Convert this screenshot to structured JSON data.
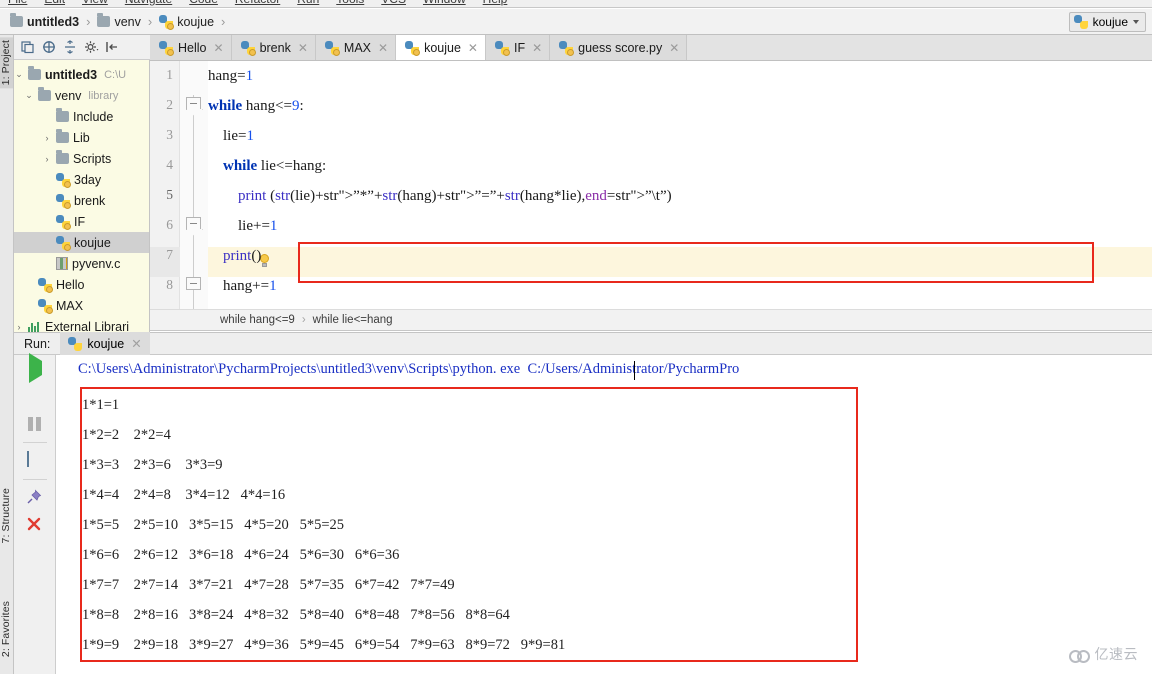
{
  "menubar": {
    "items": [
      "File",
      "Edit",
      "View",
      "Navigate",
      "Code",
      "Refactor",
      "Run",
      "Tools",
      "VCS",
      "Window",
      "Help"
    ]
  },
  "navbar": {
    "crumb_project": "untitled3",
    "crumb_venv": "venv",
    "crumb_file": "koujue",
    "separator": "›",
    "run_config": "koujue"
  },
  "toolstrip": {
    "project_tab": "1: Project",
    "structure_tab": "7: Structure",
    "favorites_tab": "2: Favorites"
  },
  "project": {
    "title": "Project",
    "toolbar_icons": [
      "select-opened-file-icon",
      "collapse-icon",
      "expand-icon",
      "settings-gear-icon",
      "hide-icon"
    ],
    "tree": [
      {
        "label": "untitled3",
        "sub": "C:\\U",
        "bold": true,
        "arrow": "⌄",
        "icon": "folder",
        "indent": 8,
        "selected": false
      },
      {
        "label": "venv",
        "sub": "library",
        "bold": false,
        "arrow": "⌄",
        "icon": "folder",
        "indent": 22,
        "selected": false
      },
      {
        "label": "Include",
        "sub": "",
        "bold": false,
        "arrow": "",
        "icon": "folder",
        "indent": 40,
        "selected": false
      },
      {
        "label": "Lib",
        "sub": "",
        "bold": false,
        "arrow": "›",
        "icon": "folder",
        "indent": 40,
        "selected": false
      },
      {
        "label": "Scripts",
        "sub": "",
        "bold": false,
        "arrow": "›",
        "icon": "folder",
        "indent": 40,
        "selected": false
      },
      {
        "label": "3day",
        "sub": "",
        "bold": false,
        "arrow": "",
        "icon": "python",
        "indent": 40,
        "selected": false
      },
      {
        "label": "brenk",
        "sub": "",
        "bold": false,
        "arrow": "",
        "icon": "python",
        "indent": 40,
        "selected": false
      },
      {
        "label": "IF",
        "sub": "",
        "bold": false,
        "arrow": "",
        "icon": "python",
        "indent": 40,
        "selected": false
      },
      {
        "label": "koujue",
        "sub": "",
        "bold": false,
        "arrow": "",
        "icon": "python",
        "indent": 40,
        "selected": true
      },
      {
        "label": "pyvenv.c",
        "sub": "",
        "bold": false,
        "arrow": "",
        "icon": "pyvenv",
        "indent": 40,
        "selected": false
      },
      {
        "label": "Hello",
        "sub": "",
        "bold": false,
        "arrow": "",
        "icon": "python",
        "indent": 22,
        "selected": false
      },
      {
        "label": "MAX",
        "sub": "",
        "bold": false,
        "arrow": "",
        "icon": "python",
        "indent": 22,
        "selected": false
      },
      {
        "label": "External Librari",
        "sub": "",
        "bold": false,
        "arrow": "›",
        "icon": "lib",
        "indent": 6,
        "selected": false
      }
    ]
  },
  "editor_tabs": [
    {
      "label": "Hello",
      "active": false
    },
    {
      "label": "brenk",
      "active": false
    },
    {
      "label": "MAX",
      "active": false
    },
    {
      "label": "koujue",
      "active": true
    },
    {
      "label": "IF",
      "active": false
    },
    {
      "label": "guess score.py",
      "active": false
    }
  ],
  "editor": {
    "line_numbers": [
      "1",
      "2",
      "3",
      "4",
      "5",
      "6",
      "7",
      "8"
    ],
    "highlighted_line": 5,
    "code_lines": [
      "hang=1",
      "while hang<=9:",
      "    lie=1",
      "    while lie<=hang:",
      "        print (str(lie)+\"*\"+str(hang)+\"=\"+str(hang*lie),end=\"\\t\")",
      "        lie+=1",
      "    print()",
      "    hang+=1"
    ],
    "breadcrumb": [
      "while hang<=9",
      "while lie<=hang"
    ],
    "breadcrumb_separator": "›"
  },
  "run_panel": {
    "label": "Run:",
    "tab_name": "koujue",
    "toolbar_icons": [
      "run-icon",
      "stop-icon",
      "pause-icon",
      "layout-icon",
      "pin-icon",
      "close-icon"
    ],
    "command": "C:\\Users\\Administrator\\PycharmProjects\\untitled3\\venv\\Scripts\\python. exe  C:/Users/Administrator/PycharmPro",
    "output_lines": [
      "1*1=1",
      "1*2=2    2*2=4",
      "1*3=3    2*3=6    3*3=9",
      "1*4=4    2*4=8    3*4=12   4*4=16",
      "1*5=5    2*5=10   3*5=15   4*5=20   5*5=25",
      "1*6=6    2*6=12   3*6=18   4*6=24   5*6=30   6*6=36",
      "1*7=7    2*7=14   3*7=21   4*7=28   5*7=35   6*7=42   7*7=49",
      "1*8=8    2*8=16   3*8=24   4*8=32   5*8=40   6*8=48   7*8=56   8*8=64",
      "1*9=9    2*9=18   3*9=27   4*9=36   5*9=45   6*9=54   7*9=63   8*9=72   9*9=81"
    ]
  },
  "watermark": {
    "text": "亿速云"
  },
  "colors": {
    "accent_red": "#e8291c",
    "keyword_blue": "#0033b3",
    "number_blue": "#1750eb",
    "string_green": "#0b7a6b",
    "highlight_row": "#fdf6dd",
    "panel_yellow": "#fbfbe4",
    "console_blue": "#1a2fc4"
  }
}
